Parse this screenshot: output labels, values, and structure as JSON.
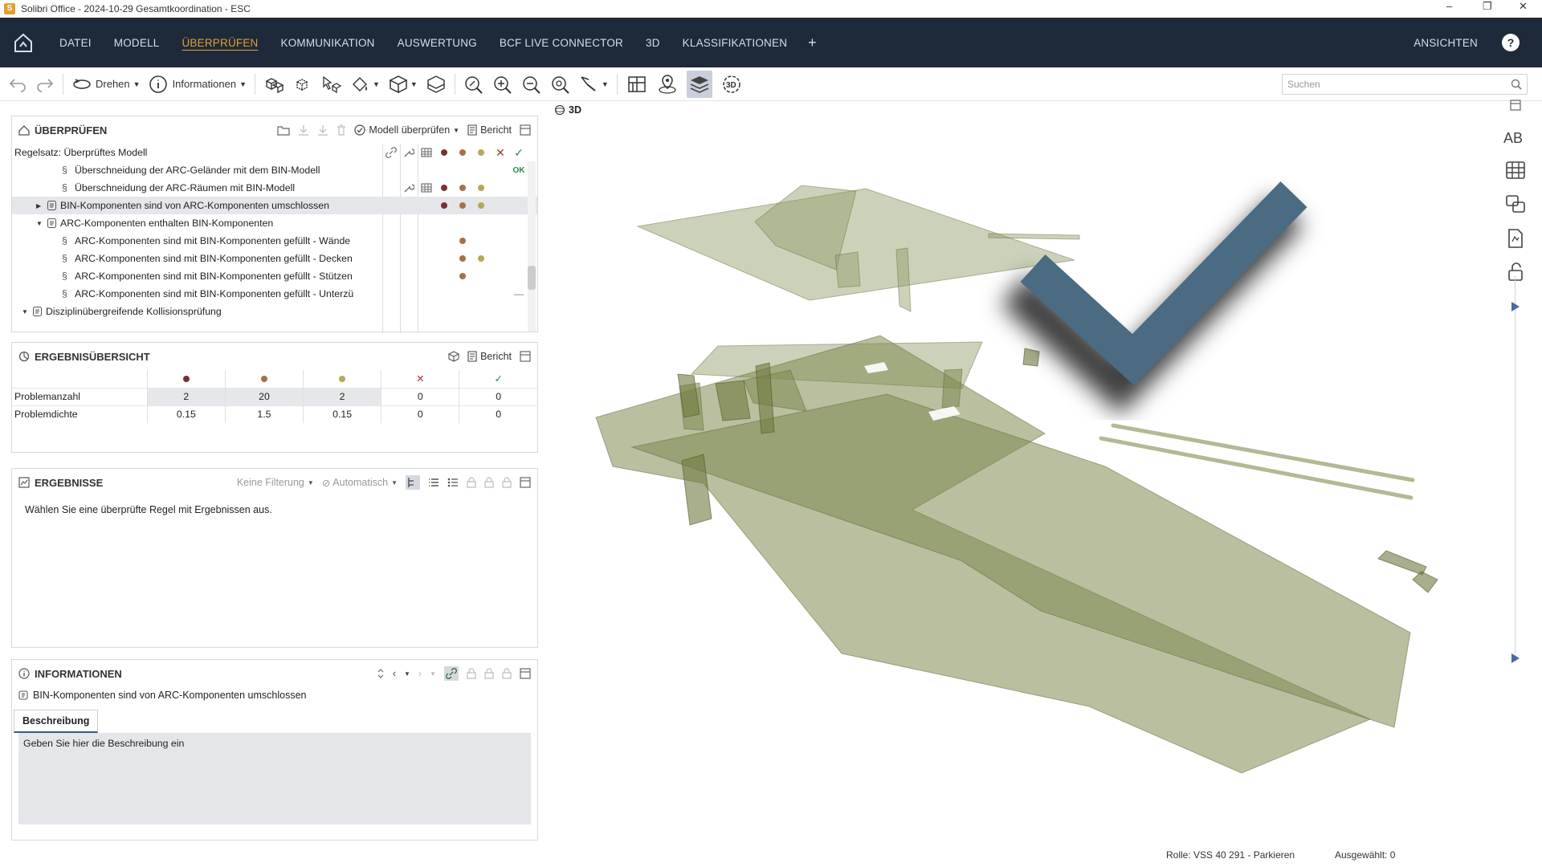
{
  "window": {
    "title": "Solibri Office - 2024-10-29 Gesamtkoordination - ESC",
    "logo_letter": "S"
  },
  "menu": {
    "items": [
      "DATEI",
      "MODELL",
      "ÜBERPRÜFEN",
      "KOMMUNIKATION",
      "AUSWERTUNG",
      "BCF LIVE CONNECTOR",
      "3D",
      "KLASSIFIKATIONEN"
    ],
    "active": "ÜBERPRÜFEN",
    "plus": "+",
    "right": "ANSICHTEN",
    "help": "?"
  },
  "toolbar": {
    "rotate": "Drehen",
    "info": "Informationen",
    "search_placeholder": "Suchen"
  },
  "check_panel": {
    "title": "ÜBERPRÜFEN",
    "check_model": "Modell überprüfen",
    "report": "Bericht",
    "ruleset_label": "Regelsatz: Überprüftes Modell",
    "rows": [
      {
        "indent": 4,
        "kind": "rule",
        "text": "Überschneidung der ARC-Geländer mit dem BIN-Modell",
        "ok": "OK"
      },
      {
        "indent": 4,
        "kind": "rule",
        "text": "Überschneidung der ARC-Räumen mit BIN-Modell",
        "dots": [
          1,
          1,
          1
        ],
        "tools": true
      },
      {
        "indent": 3,
        "kind": "folder",
        "expand": "right",
        "text": "BIN-Komponenten sind von ARC-Komponenten umschlossen",
        "dots": [
          1,
          1,
          1
        ],
        "selected": true
      },
      {
        "indent": 3,
        "kind": "folder",
        "expand": "down",
        "text": "ARC-Komponenten enthalten BIN-Komponenten"
      },
      {
        "indent": 4,
        "kind": "rule",
        "text": "ARC-Komponenten sind mit BIN-Komponenten gefüllt - Wände",
        "dots": [
          0,
          1,
          0
        ]
      },
      {
        "indent": 4,
        "kind": "rule",
        "text": "ARC-Komponenten sind mit BIN-Komponenten gefüllt - Decken",
        "dots": [
          0,
          1,
          1
        ]
      },
      {
        "indent": 4,
        "kind": "rule",
        "text": "ARC-Komponenten sind mit BIN-Komponenten gefüllt - Stützen",
        "dots": [
          0,
          1,
          0
        ]
      },
      {
        "indent": 4,
        "kind": "rule",
        "text": "ARC-Komponenten sind mit BIN-Komponenten gefüllt - Unterzü",
        "dash": "—"
      },
      {
        "indent": 2,
        "kind": "folder",
        "expand": "down",
        "text": "Disziplinübergreifende Kollisionsprüfung"
      }
    ]
  },
  "summary_panel": {
    "title": "ERGEBNISÜBERSICHT",
    "report": "Bericht",
    "rows": [
      {
        "label": "Problemanzahl",
        "values": [
          "2",
          "20",
          "2",
          "0",
          "0"
        ]
      },
      {
        "label": "Problemdichte",
        "values": [
          "0.15",
          "1.5",
          "0.15",
          "0",
          "0"
        ]
      }
    ]
  },
  "results_panel": {
    "title": "ERGEBNISSE",
    "filter": "Keine Filterung",
    "auto": "Automatisch",
    "empty_text": "Wählen Sie eine überprüfte Regel mit Ergebnissen aus."
  },
  "info_panel": {
    "title": "INFORMATIONEN",
    "rule_name": "BIN-Komponenten sind von ARC-Komponenten umschlossen",
    "tab": "Beschreibung",
    "description": "Geben Sie hier die Beschreibung ein"
  },
  "viewport": {
    "label": "3D",
    "side_text": "AB"
  },
  "status": {
    "role": "Rolle: VSS 40 291 - Parkieren",
    "selected": "Ausgewählt: 0"
  },
  "colors": {
    "critical": "#7a3038",
    "moderate": "#a8704a",
    "low": "#b2aa5a",
    "menubar": "#1e2a3a",
    "accent": "#e0a030",
    "check": "#4a6b82",
    "model": "#8a9460"
  }
}
